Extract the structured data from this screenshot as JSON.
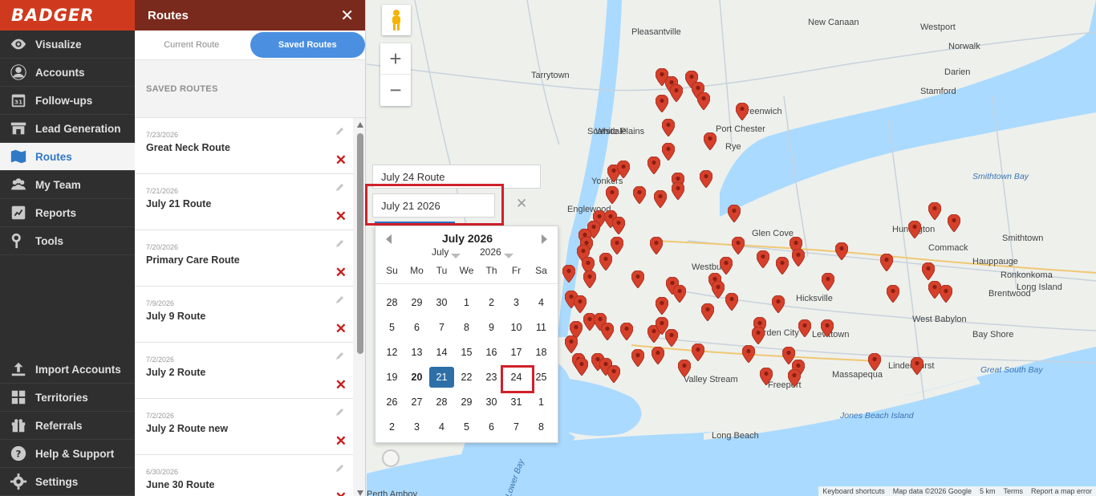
{
  "app": {
    "logo": "BADGER"
  },
  "nav": {
    "items": [
      {
        "label": "Visualize",
        "icon": "eye-icon"
      },
      {
        "label": "Accounts",
        "icon": "user-circle-icon"
      },
      {
        "label": "Follow-ups",
        "icon": "calendar-31-icon"
      },
      {
        "label": "Lead Generation",
        "icon": "storefront-icon"
      },
      {
        "label": "Routes",
        "icon": "map-icon",
        "active": true
      },
      {
        "label": "My Team",
        "icon": "team-icon"
      },
      {
        "label": "Reports",
        "icon": "report-icon"
      },
      {
        "label": "Tools",
        "icon": "wrench-icon"
      }
    ],
    "bottom_items": [
      {
        "label": "Import Accounts",
        "icon": "upload-icon"
      },
      {
        "label": "Territories",
        "icon": "territories-icon"
      },
      {
        "label": "Referrals",
        "icon": "gift-icon"
      },
      {
        "label": "Help & Support",
        "icon": "help-icon"
      },
      {
        "label": "Settings",
        "icon": "gear-icon"
      }
    ]
  },
  "panel": {
    "title": "Routes",
    "close": "✕",
    "tabs": {
      "current": "Current Route",
      "saved": "Saved Routes"
    },
    "saved_heading": "SAVED ROUTES",
    "routes": [
      {
        "date": "7/23/2026",
        "name": "Great Neck Route"
      },
      {
        "date": "7/21/2026",
        "name": "July 21 Route"
      },
      {
        "date": "7/20/2026",
        "name": "Primary Care Route"
      },
      {
        "date": "7/9/2026",
        "name": "July 9 Route"
      },
      {
        "date": "7/2/2026",
        "name": "July 2 Route"
      },
      {
        "date": "7/2/2026",
        "name": "July 2 Route new"
      },
      {
        "date": "6/30/2026",
        "name": "June 30 Route"
      }
    ],
    "delete_glyph": "✕"
  },
  "route_form": {
    "name_value": "July 24 Route",
    "date_value": "July 21 2026",
    "clear": "✕"
  },
  "calendar": {
    "title": "July 2026",
    "month_select": "July",
    "year_select": "2026",
    "dow": [
      "Su",
      "Mo",
      "Tu",
      "We",
      "Th",
      "Fr",
      "Sa"
    ],
    "weeks": [
      [
        "28",
        "29",
        "30",
        "1",
        "2",
        "3",
        "4"
      ],
      [
        "5",
        "6",
        "7",
        "8",
        "9",
        "10",
        "11"
      ],
      [
        "12",
        "13",
        "14",
        "15",
        "16",
        "17",
        "18"
      ],
      [
        "19",
        "20",
        "21",
        "22",
        "23",
        "24",
        "25"
      ],
      [
        "26",
        "27",
        "28",
        "29",
        "30",
        "31",
        "1"
      ],
      [
        "2",
        "3",
        "4",
        "5",
        "6",
        "7",
        "8"
      ]
    ],
    "today": "20",
    "selected": "21"
  },
  "map": {
    "labels": [
      "Pleasantville",
      "New Canaan",
      "Westport",
      "Norwalk",
      "Darien",
      "Tarrytown",
      "White Plains",
      "Stamford",
      "Greenwich",
      "Port Chester",
      "Scarsdale",
      "Rye",
      "Yonkers",
      "Englewood",
      "Glen Cove",
      "Huntington",
      "Commack",
      "Smithtown",
      "Hauppauge",
      "Ronkonkoma",
      "Long Island",
      "Brentwood",
      "Hicksville",
      "West Babylon",
      "Bay Shore",
      "Levittown",
      "Massapequa",
      "Lindenhurst",
      "Freeport",
      "Valley Stream",
      "Long Beach",
      "Garden City",
      "Westbury",
      "Perth Amboy"
    ],
    "water_labels": [
      "Smithtown Bay",
      "Great South Bay",
      "Jones Beach Island",
      "Lower Bay"
    ],
    "attribution": [
      "Keyboard shortcuts",
      "Map data ©2026 Google",
      "5 km",
      "Terms",
      "Report a map error"
    ],
    "controls": {
      "zoom_in": "+",
      "zoom_out": "−"
    },
    "colors": {
      "water": "#aadaff",
      "land": "#eef0ec",
      "pin": "#d6402b"
    }
  }
}
